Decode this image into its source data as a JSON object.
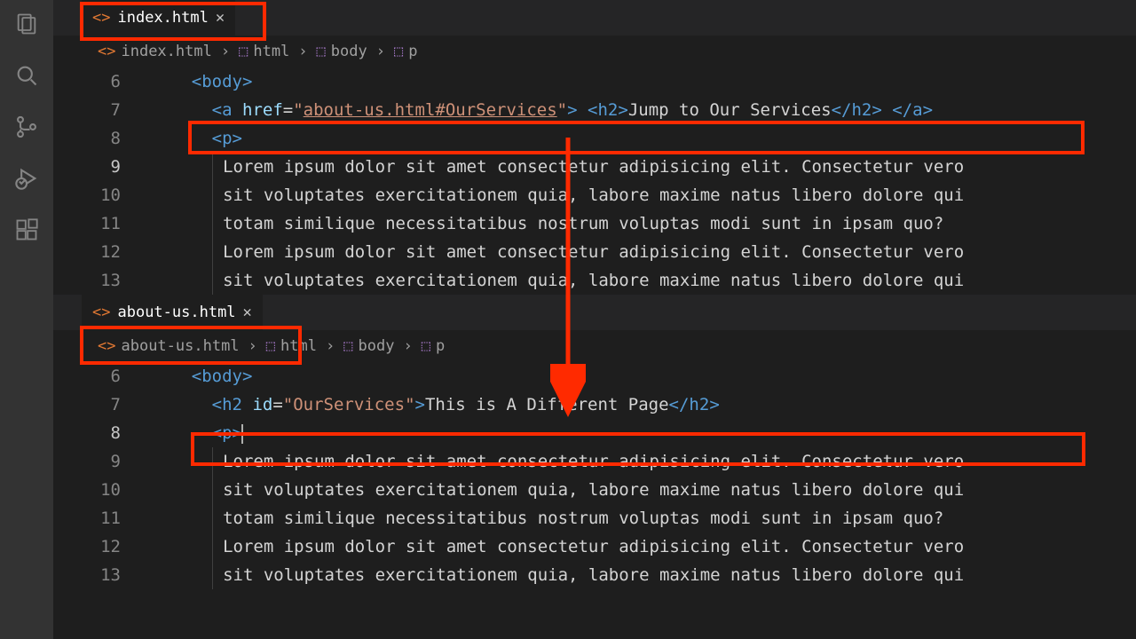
{
  "activity": {
    "explorer": "explorer-icon",
    "search": "search-icon",
    "scm": "source-control-icon",
    "debug": "debug-icon",
    "extensions": "extensions-icon"
  },
  "pane1": {
    "tab": {
      "filename": "index.html"
    },
    "breadcrumb": {
      "file": "index.html",
      "seg1": "html",
      "seg2": "body",
      "seg3": "p"
    },
    "lines": {
      "n6": "6",
      "n7": "7",
      "n8": "8",
      "n9": "9",
      "n10": "10",
      "n11": "11",
      "n12": "12",
      "n13": "13"
    },
    "code": {
      "l6_body": "body",
      "l7_a": "a",
      "l7_href": "href",
      "l7_val": "about-us.html#OurServices",
      "l7_h2": "h2",
      "l7_text": "Jump to Our Services",
      "l8_p": "p",
      "l9": "Lorem ipsum dolor sit amet consectetur adipisicing elit. Consectetur vero",
      "l10": "sit voluptates exercitationem quia, labore maxime natus libero dolore qui",
      "l11": "totam similique necessitatibus nostrum voluptas modi sunt in ipsam quo?",
      "l12": "Lorem ipsum dolor sit amet consectetur adipisicing elit. Consectetur vero",
      "l13": "sit voluptates exercitationem quia, labore maxime natus libero dolore qui"
    }
  },
  "pane2": {
    "tab": {
      "filename": "about-us.html"
    },
    "breadcrumb": {
      "file": "about-us.html",
      "seg1": "html",
      "seg2": "body",
      "seg3": "p"
    },
    "lines": {
      "n6": "6",
      "n7": "7",
      "n8": "8",
      "n9": "9",
      "n10": "10",
      "n11": "11",
      "n12": "12",
      "n13": "13"
    },
    "code": {
      "l6_body": "body",
      "l7_h2": "h2",
      "l7_id": "id",
      "l7_val": "OurServices",
      "l7_text": "This is A Different Page",
      "l8_p": "p",
      "l9": "Lorem ipsum dolor sit amet consectetur adipisicing elit. Consectetur vero",
      "l10": "sit voluptates exercitationem quia, labore maxime natus libero dolore qui",
      "l11": "totam similique necessitatibus nostrum voluptas modi sunt in ipsam quo?",
      "l12": "Lorem ipsum dolor sit amet consectetur adipisicing elit. Consectetur vero",
      "l13": "sit voluptates exercitationem quia, labore maxime natus libero dolore qui"
    }
  }
}
